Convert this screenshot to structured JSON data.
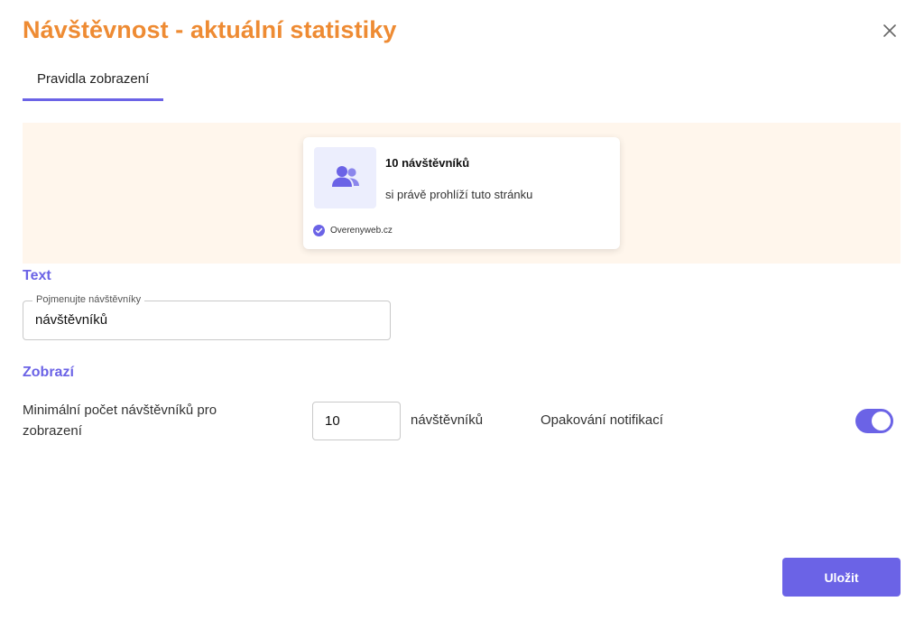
{
  "modal": {
    "title": "Návštěvnost - aktuální statistiky",
    "close_icon": "close-icon"
  },
  "tabs": [
    {
      "label": "Pravidla zobrazení",
      "active": true
    }
  ],
  "preview": {
    "count_text": "10 návštěvníků",
    "subtitle": "si právě prohlíží tuto stránku",
    "footer_text": "Overenyweb.cz",
    "icon": "users-icon",
    "footer_icon": "check-circle-icon"
  },
  "text_section": {
    "title": "Text",
    "field_legend": "Pojmenujte návštěvníky",
    "field_value": "návštěvníků"
  },
  "display_section": {
    "title": "Zobrazí",
    "min_label": "Minimální počet návštěvníků pro zobrazení",
    "min_value": "10",
    "unit": "návštěvníků",
    "repeat_label": "Opakování notifikací",
    "repeat_enabled": true
  },
  "actions": {
    "save_label": "Uložit"
  },
  "colors": {
    "title": "#ee8b33",
    "accent": "#6b63e6",
    "preview_bg": "#fff6ec",
    "icon_bg": "#eceefd"
  }
}
